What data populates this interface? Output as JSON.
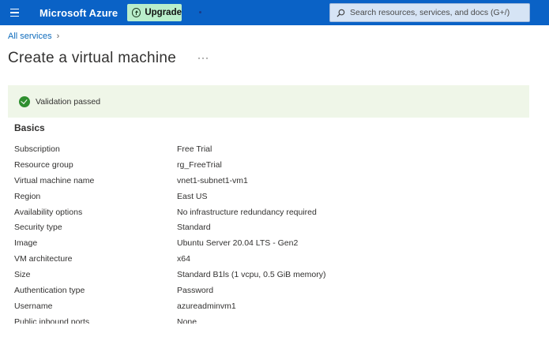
{
  "topbar": {
    "brand": "Microsoft Azure",
    "upgrade_label": "Upgrade",
    "search_placeholder": "Search resources, services, and docs (G+/)"
  },
  "breadcrumb": {
    "items": [
      "All services"
    ]
  },
  "page": {
    "title": "Create a virtual machine",
    "more": "···"
  },
  "banner": {
    "message": "Validation passed",
    "status_color": "#2f8f2f",
    "background": "#eff6e8"
  },
  "basics": {
    "title": "Basics",
    "rows": [
      {
        "label": "Subscription",
        "value": "Free Trial"
      },
      {
        "label": "Resource group",
        "value": "rg_FreeTrial"
      },
      {
        "label": "Virtual machine name",
        "value": "vnet1-subnet1-vm1"
      },
      {
        "label": "Region",
        "value": "East US"
      },
      {
        "label": "Availability options",
        "value": "No infrastructure redundancy required"
      },
      {
        "label": "Security type",
        "value": "Standard"
      },
      {
        "label": "Image",
        "value": "Ubuntu Server 20.04 LTS - Gen2"
      },
      {
        "label": "VM architecture",
        "value": "x64"
      },
      {
        "label": "Size",
        "value": "Standard B1ls (1 vcpu, 0.5 GiB memory)"
      },
      {
        "label": "Authentication type",
        "value": "Password"
      },
      {
        "label": "Username",
        "value": "azureadminvm1"
      },
      {
        "label": "Public inbound ports",
        "value": "None"
      }
    ]
  },
  "colors": {
    "topbar": "#0a62c6",
    "upgrade": "#b9eecb",
    "link": "#0f6cbd"
  },
  "icons": [
    "hamburger-menu-icon",
    "upgrade-icon",
    "search-icon",
    "chevron-right-icon",
    "check-circle-icon"
  ]
}
